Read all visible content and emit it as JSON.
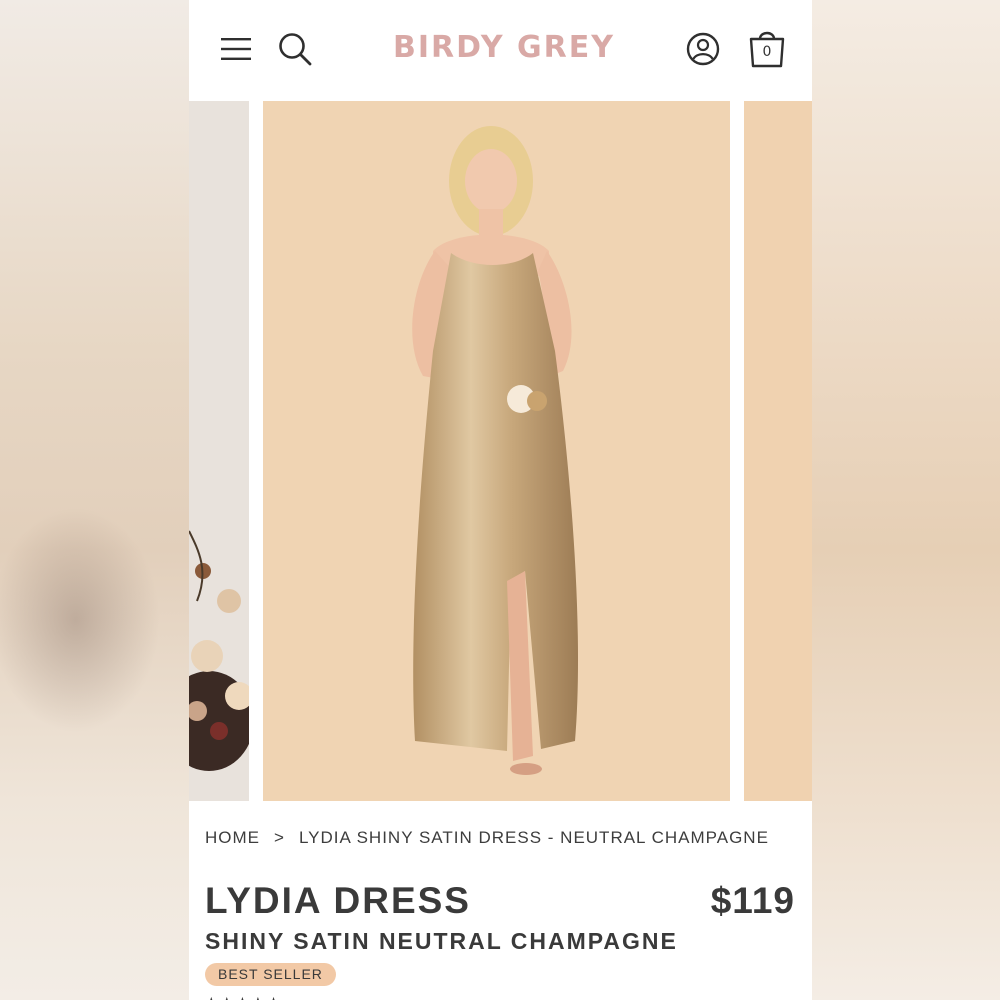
{
  "header": {
    "brand": "BIRDY GREY",
    "cart_count": "0",
    "icons": [
      "menu-icon",
      "search-icon",
      "account-icon",
      "shopping-bag-icon"
    ]
  },
  "gallery": {
    "colors": {
      "main_backdrop": "#f0d4b3",
      "dress": "#cdb08a"
    }
  },
  "breadcrumb": {
    "items": [
      "HOME",
      "LYDIA SHINY SATIN DRESS - NEUTRAL CHAMPAGNE"
    ],
    "separator": ">"
  },
  "product": {
    "title": "LYDIA DRESS",
    "price": "$119",
    "subtitle": "SHINY SATIN NEUTRAL CHAMPAGNE",
    "badge": "BEST SELLER"
  },
  "colors": {
    "brand": "#d9a9a6",
    "badge_bg": "#f2c9a6",
    "text": "#3a3a3a"
  }
}
